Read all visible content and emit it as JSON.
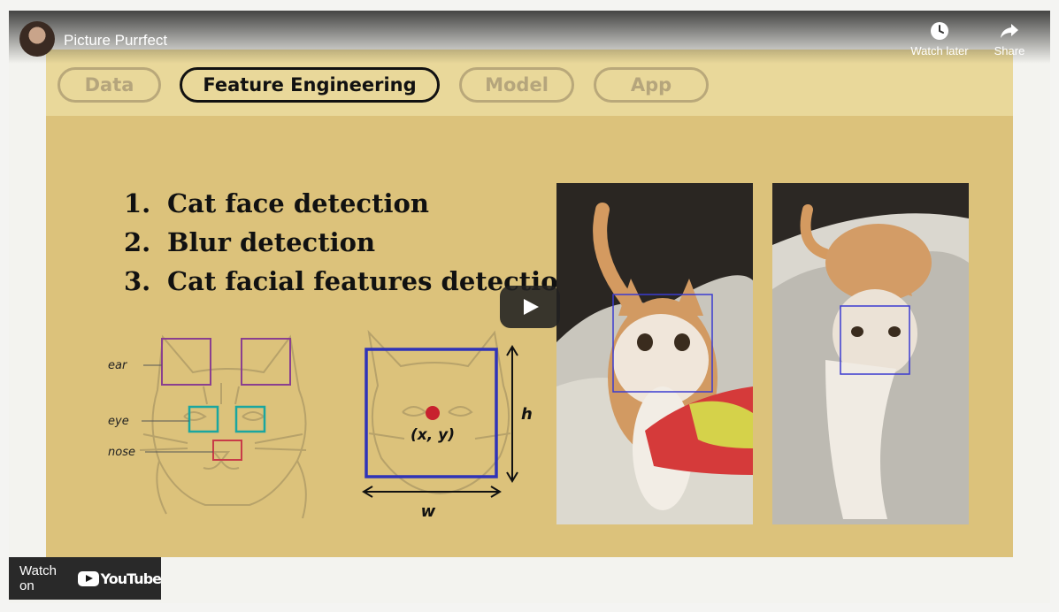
{
  "header": {
    "channel_title": "Picture Purrfect",
    "watch_later_label": "Watch later",
    "share_label": "Share"
  },
  "slide": {
    "tabs": [
      {
        "label": "Data",
        "active": false
      },
      {
        "label": "Feature Engineering",
        "active": true
      },
      {
        "label": "Model",
        "active": false
      },
      {
        "label": "App",
        "active": false
      }
    ],
    "steps": [
      {
        "num": "1.",
        "text": "Cat face detection"
      },
      {
        "num": "2.",
        "text": "Blur detection"
      },
      {
        "num": "3.",
        "text": "Cat facial features detection"
      }
    ],
    "diagram_labels": {
      "ear": "ear",
      "eye": "eye",
      "nose": "nose",
      "center": "(x, y)",
      "height": "h",
      "width": "w"
    }
  },
  "footer": {
    "watch_on_label": "Watch on",
    "youtube_label": "YouTube"
  },
  "icons": [
    "avatar",
    "clock-icon",
    "share-arrow-icon",
    "play-icon",
    "youtube-logo-icon"
  ],
  "colors": {
    "slide_bg": "#dcc27b",
    "tab_bar_bg": "#e9d89a",
    "ear_box": "#8a3f8f",
    "eye_box": "#1aa6a0",
    "nose_box": "#c83b48",
    "face_box": "#2f33b8",
    "center_dot": "#c8212e"
  }
}
